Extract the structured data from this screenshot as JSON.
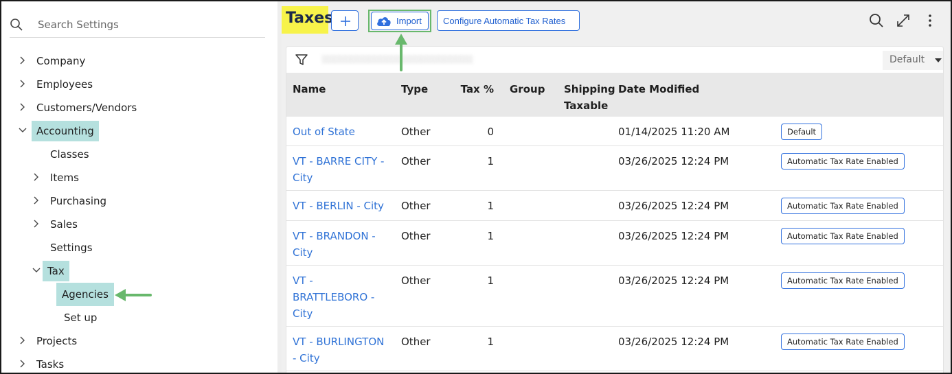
{
  "sidebar": {
    "search_placeholder": "Search Settings",
    "items": [
      {
        "label": "Company",
        "state": "collapsed"
      },
      {
        "label": "Employees",
        "state": "collapsed"
      },
      {
        "label": "Customers/Vendors",
        "state": "collapsed"
      },
      {
        "label": "Accounting",
        "state": "expanded",
        "selected": true
      },
      {
        "label": "Classes"
      },
      {
        "label": "Items",
        "state": "collapsed"
      },
      {
        "label": "Purchasing",
        "state": "collapsed"
      },
      {
        "label": "Sales",
        "state": "collapsed"
      },
      {
        "label": "Settings"
      },
      {
        "label": "Tax",
        "state": "expanded",
        "selected": true
      },
      {
        "label": "Agencies",
        "selected": true
      },
      {
        "label": "Set up"
      },
      {
        "label": "Projects",
        "state": "collapsed"
      },
      {
        "label": "Tasks",
        "state": "collapsed"
      }
    ]
  },
  "header": {
    "title": "Taxes",
    "add_icon": "plus-icon",
    "import_label": "Import",
    "import_icon": "cloud-upload-icon",
    "config_label": "Configure Automatic Tax Rates",
    "actions": [
      "search-icon",
      "expand-icon",
      "more-vertical-icon"
    ]
  },
  "toolbar": {
    "filter_icon": "filter-icon",
    "view_select": "Default"
  },
  "table": {
    "columns": [
      "Name",
      "Type",
      "Tax %",
      "Group",
      "Shipping Taxable",
      "Date Modified"
    ],
    "rows": [
      {
        "name": "Out of State",
        "type": "Other",
        "tax": "0",
        "group": "",
        "shipping": "",
        "date": "01/14/2025 11:20 AM",
        "badge": "Default"
      },
      {
        "name": "VT - BARRE CITY - City",
        "type": "Other",
        "tax": "1",
        "group": "",
        "shipping": "",
        "date": "03/26/2025 12:24 PM",
        "badge": "Automatic Tax Rate Enabled"
      },
      {
        "name": "VT - BERLIN - City",
        "type": "Other",
        "tax": "1",
        "group": "",
        "shipping": "",
        "date": "03/26/2025 12:24 PM",
        "badge": "Automatic Tax Rate Enabled"
      },
      {
        "name": "VT - BRANDON - City",
        "type": "Other",
        "tax": "1",
        "group": "",
        "shipping": "",
        "date": "03/26/2025 12:24 PM",
        "badge": "Automatic Tax Rate Enabled"
      },
      {
        "name": "VT - BRATTLEBORO - City",
        "type": "Other",
        "tax": "1",
        "group": "",
        "shipping": "",
        "date": "03/26/2025 12:24 PM",
        "badge": "Automatic Tax Rate Enabled"
      },
      {
        "name": "VT - BURLINGTON - City",
        "type": "Other",
        "tax": "1",
        "group": "",
        "shipping": "",
        "date": "03/26/2025 12:24 PM",
        "badge": "Automatic Tax Rate Enabled"
      }
    ]
  },
  "colors": {
    "selected_bg": "#b5e0de",
    "title_highlight": "#f7f34a",
    "callout_green": "#68b86c",
    "link_blue": "#2f72d6",
    "button_border": "#2f6fde"
  }
}
